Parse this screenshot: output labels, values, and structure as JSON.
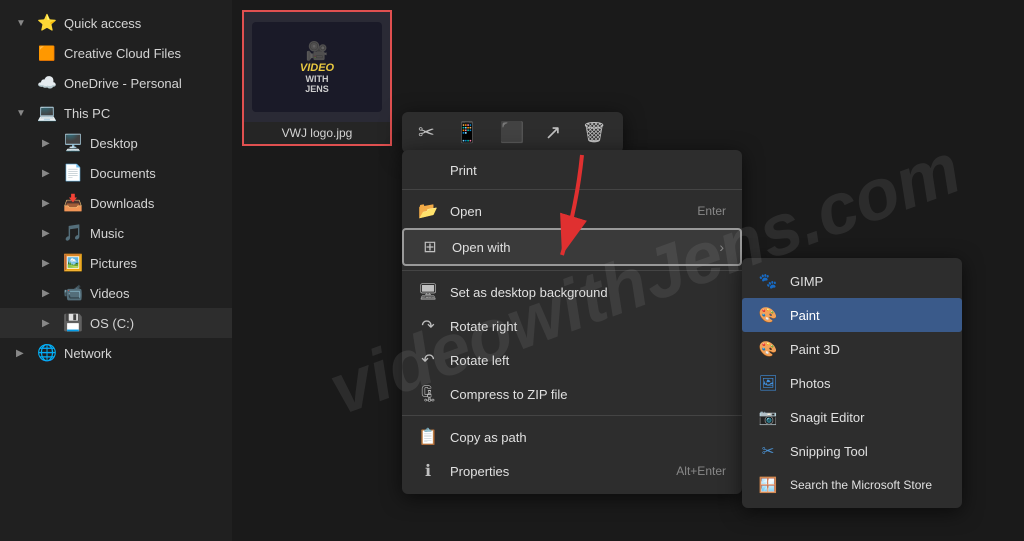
{
  "sidebar": {
    "items": [
      {
        "id": "quick-access",
        "label": "Quick access",
        "icon": "⭐",
        "indent": 0,
        "expanded": true
      },
      {
        "id": "creative-cloud",
        "label": "Creative Cloud Files",
        "icon": "🟧",
        "indent": 0
      },
      {
        "id": "onedrive",
        "label": "OneDrive - Personal",
        "icon": "☁️",
        "indent": 0
      },
      {
        "id": "this-pc",
        "label": "This PC",
        "icon": "💻",
        "indent": 0,
        "expanded": true
      },
      {
        "id": "desktop",
        "label": "Desktop",
        "icon": "🖥️",
        "indent": 1
      },
      {
        "id": "documents",
        "label": "Documents",
        "icon": "📄",
        "indent": 1
      },
      {
        "id": "downloads",
        "label": "Downloads",
        "icon": "📥",
        "indent": 1
      },
      {
        "id": "music",
        "label": "Music",
        "icon": "🎵",
        "indent": 1
      },
      {
        "id": "pictures",
        "label": "Pictures",
        "icon": "🖼️",
        "indent": 1
      },
      {
        "id": "videos",
        "label": "Videos",
        "icon": "📹",
        "indent": 1
      },
      {
        "id": "os-c",
        "label": "OS (C:)",
        "icon": "💾",
        "indent": 1,
        "selected": true
      },
      {
        "id": "network",
        "label": "Network",
        "icon": "🌐",
        "indent": 0
      }
    ]
  },
  "file": {
    "name": "VWJ logo.jpg",
    "thumb_line1": "VIDEO",
    "thumb_line2": "WITH",
    "thumb_line3": "JENS"
  },
  "context_menu": {
    "toolbar_icons": [
      "✂️",
      "📱",
      "⬛",
      "↗️",
      "🗑️"
    ],
    "print_label": "Print",
    "items": [
      {
        "id": "open",
        "label": "Open",
        "shortcut": "Enter",
        "icon": "📂"
      },
      {
        "id": "open-with",
        "label": "Open with",
        "shortcut": "",
        "icon": "⊞",
        "has_arrow": true,
        "highlighted": true
      },
      {
        "id": "set-desktop",
        "label": "Set as desktop background",
        "shortcut": "",
        "icon": "🖥️"
      },
      {
        "id": "rotate-right",
        "label": "Rotate right",
        "shortcut": "",
        "icon": "↷"
      },
      {
        "id": "rotate-left",
        "label": "Rotate left",
        "shortcut": "",
        "icon": "↶"
      },
      {
        "id": "compress-zip",
        "label": "Compress to ZIP file",
        "shortcut": "",
        "icon": "🗜️"
      },
      {
        "id": "copy-path",
        "label": "Copy as path",
        "shortcut": "",
        "icon": "📋"
      },
      {
        "id": "properties",
        "label": "Properties",
        "shortcut": "Alt+Enter",
        "icon": "ℹ️"
      }
    ]
  },
  "submenu": {
    "items": [
      {
        "id": "gimp",
        "label": "GIMP",
        "icon": "🐾"
      },
      {
        "id": "paint",
        "label": "Paint",
        "icon": "🎨",
        "highlighted": true
      },
      {
        "id": "paint-3d",
        "label": "Paint 3D",
        "icon": "🎨"
      },
      {
        "id": "photos",
        "label": "Photos",
        "icon": "🖼️"
      },
      {
        "id": "snagit",
        "label": "Snagit Editor",
        "icon": "📷"
      },
      {
        "id": "snipping",
        "label": "Snipping Tool",
        "icon": "✂️"
      },
      {
        "id": "ms-store",
        "label": "Search the Microsoft Store",
        "icon": "🪟"
      }
    ]
  },
  "watermark": {
    "text": "videowithJens.com"
  }
}
